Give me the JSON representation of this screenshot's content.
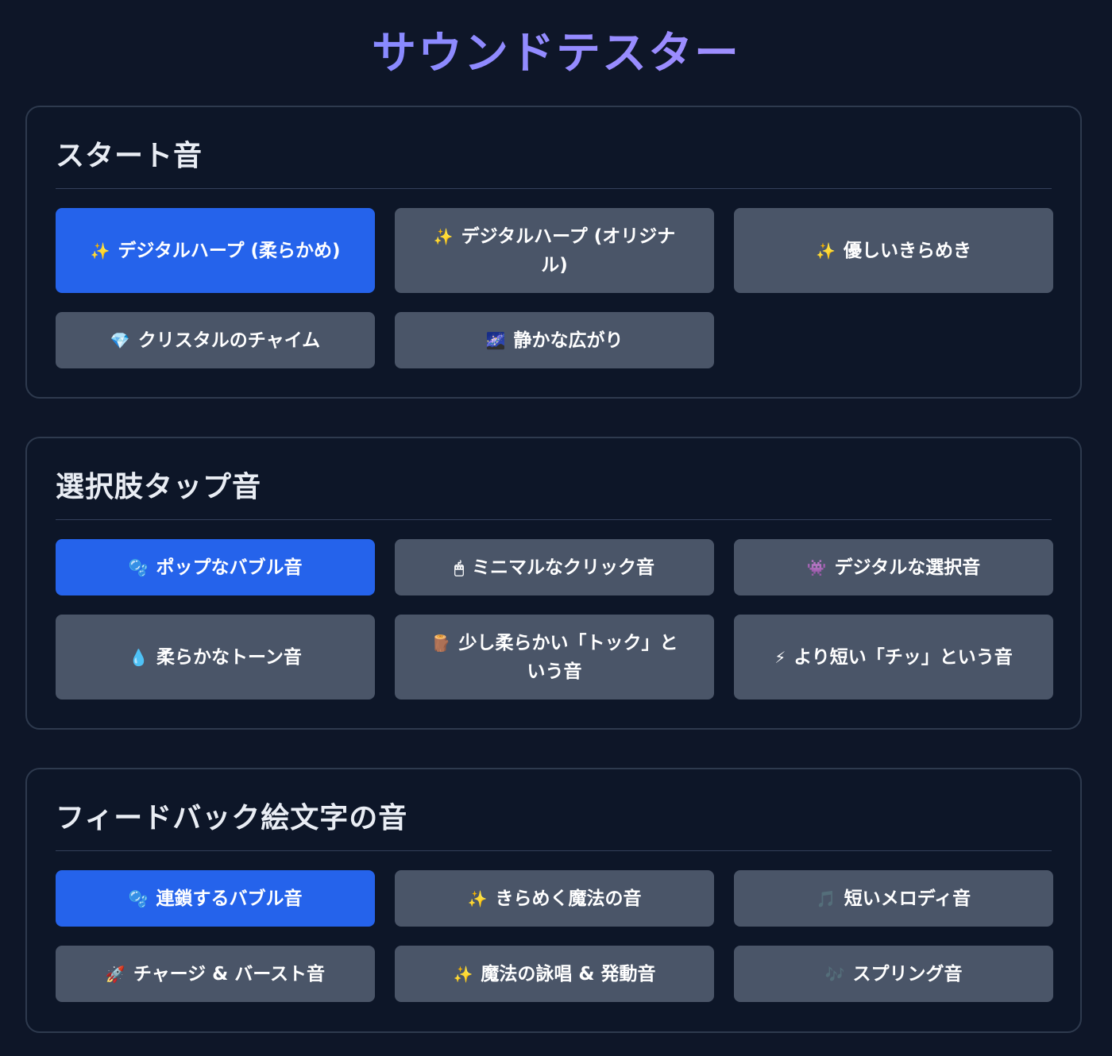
{
  "title": "サウンドテスター",
  "sections": [
    {
      "title": "スタート音",
      "buttons": [
        {
          "icon": "✨",
          "label": "デジタルハープ (柔らかめ)",
          "active": true
        },
        {
          "icon": "✨",
          "label": "デジタルハープ (オリジナル)",
          "active": false
        },
        {
          "icon": "✨",
          "label": "優しいきらめき",
          "active": false
        },
        {
          "icon": "💎",
          "label": "クリスタルのチャイム",
          "active": false
        },
        {
          "icon": "🌌",
          "label": "静かな広がり",
          "active": false
        }
      ]
    },
    {
      "title": "選択肢タップ音",
      "buttons": [
        {
          "icon": "🫧",
          "label": "ポップなバブル音",
          "active": true
        },
        {
          "icon": "🖱",
          "label": "ミニマルなクリック音",
          "active": false
        },
        {
          "icon": "👾",
          "label": "デジタルな選択音",
          "active": false
        },
        {
          "icon": "💧",
          "label": "柔らかなトーン音",
          "active": false
        },
        {
          "icon": "🪵",
          "label": "少し柔らかい「トック」という音",
          "active": false
        },
        {
          "icon": "⚡",
          "label": "より短い「チッ」という音",
          "active": false
        }
      ]
    },
    {
      "title": "フィードバック絵文字の音",
      "buttons": [
        {
          "icon": "🫧",
          "label": "連鎖するバブル音",
          "active": true
        },
        {
          "icon": "✨",
          "label": "きらめく魔法の音",
          "active": false
        },
        {
          "icon": "🎵",
          "label": "短いメロディ音",
          "active": false
        },
        {
          "icon": "🚀",
          "label": "チャージ & バースト音",
          "active": false
        },
        {
          "icon": "✨",
          "label": "魔法の詠唱 & 発動音",
          "active": false
        },
        {
          "icon": "🎶",
          "label": "スプリング音",
          "active": false
        }
      ]
    }
  ]
}
